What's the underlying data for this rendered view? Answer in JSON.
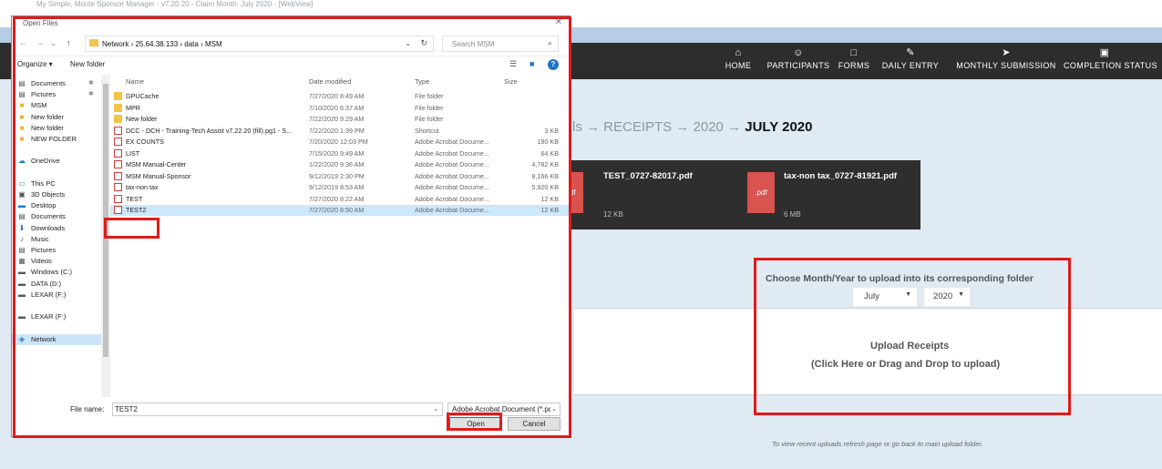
{
  "browser": {
    "tab_text": "My Simple, Monte Sponsor Manager - v7.20.20 - Claim Month: July 2020 - [WebView]"
  },
  "nav": {
    "items": [
      {
        "label": "HOME",
        "icon": "home-icon",
        "glyph": "⌂"
      },
      {
        "label": "PARTICIPANTS",
        "icon": "smile-icon",
        "glyph": "☺"
      },
      {
        "label": "FORMS",
        "icon": "clipboard-icon",
        "glyph": "□"
      },
      {
        "label": "DAILY ENTRY",
        "icon": "edit-icon",
        "glyph": "✎"
      },
      {
        "label": "MONTHLY SUBMISSION",
        "icon": "send-icon",
        "glyph": "➤"
      },
      {
        "label": "COMPLETION STATUS",
        "icon": "calendar-icon",
        "glyph": "▣"
      }
    ]
  },
  "breadcrumb": {
    "prefix": "ls → RECEIPTS → 2020 →",
    "current": "JULY 2020"
  },
  "files": [
    {
      "name": "TEST_0727-82017.pdf",
      "size": "12 KB",
      "badge": "pdf"
    },
    {
      "name": "tax-non tax_0727-81921.pdf",
      "size": "6 MB",
      "badge": ".pdf"
    }
  ],
  "upload": {
    "choose_title": "Choose Month/Year to upload into its corresponding folder",
    "month": "July",
    "year": "2020",
    "title": "Upload Receipts",
    "subtitle": "(Click Here or Drag and Drop to upload)",
    "hint": "To view recent uploads refresh page or go back to main upload folder."
  },
  "dialog": {
    "title": "Open Files",
    "address": "Network  ›  25.64.38.133  ›  data  ›  MSM",
    "search_placeholder": "Search MSM",
    "organize": "Organize ▾",
    "new_folder": "New folder",
    "nav_pane": [
      {
        "label": "Documents",
        "icon": "documents-icon",
        "glyph": "▤",
        "pinned": true
      },
      {
        "label": "Pictures",
        "icon": "pictures-icon",
        "glyph": "▤",
        "pinned": true
      },
      {
        "label": "MSM",
        "icon": "folder-icon",
        "glyph": "■"
      },
      {
        "label": "New folder",
        "icon": "folder-icon",
        "glyph": "■"
      },
      {
        "label": "New folder",
        "icon": "folder-icon",
        "glyph": "■"
      },
      {
        "label": "NEW FOLDER",
        "icon": "folder-icon",
        "glyph": "■"
      },
      {
        "label": "",
        "icon": "",
        "glyph": ""
      },
      {
        "label": "OneDrive",
        "icon": "cloud-icon",
        "glyph": "☁"
      },
      {
        "label": "",
        "icon": "",
        "glyph": ""
      },
      {
        "label": "This PC",
        "icon": "computer-icon",
        "glyph": "▭"
      },
      {
        "label": "3D Objects",
        "icon": "cube-icon",
        "glyph": "▣"
      },
      {
        "label": "Desktop",
        "icon": "desktop-icon",
        "glyph": "▬"
      },
      {
        "label": "Documents",
        "icon": "documents-icon",
        "glyph": "▤"
      },
      {
        "label": "Downloads",
        "icon": "download-icon",
        "glyph": "⬇"
      },
      {
        "label": "Music",
        "icon": "music-icon",
        "glyph": "♪"
      },
      {
        "label": "Pictures",
        "icon": "pictures-icon",
        "glyph": "▤"
      },
      {
        "label": "Videos",
        "icon": "videos-icon",
        "glyph": "▦"
      },
      {
        "label": "Windows (C:)",
        "icon": "drive-icon",
        "glyph": "▬"
      },
      {
        "label": "DATA (D:)",
        "icon": "drive-icon",
        "glyph": "▬"
      },
      {
        "label": "LEXAR (F:)",
        "icon": "drive-icon",
        "glyph": "▬"
      },
      {
        "label": "",
        "icon": "",
        "glyph": ""
      },
      {
        "label": "LEXAR (F:)",
        "icon": "drive-icon",
        "glyph": "▬"
      },
      {
        "label": "",
        "icon": "",
        "glyph": ""
      },
      {
        "label": "Network",
        "icon": "network-icon",
        "glyph": "◈",
        "selected": true
      }
    ],
    "columns": [
      "Name",
      "Date modified",
      "Type",
      "Size"
    ],
    "rows": [
      {
        "name": "GPUCache",
        "date": "7/27/2020 8:49 AM",
        "type": "File folder",
        "size": "",
        "kind": "folder"
      },
      {
        "name": "MPR",
        "date": "7/10/2020 6:37 AM",
        "type": "File folder",
        "size": "",
        "kind": "folder"
      },
      {
        "name": "New folder",
        "date": "7/22/2020 9:29 AM",
        "type": "File folder",
        "size": "",
        "kind": "folder"
      },
      {
        "name": "DCC - DCH - Training-Tech Assist v7.22.20 (fill) pg1 - S...",
        "date": "7/22/2020 1:39 PM",
        "type": "Shortcut",
        "size": "3 KB",
        "kind": "shortcut"
      },
      {
        "name": "EX COUNTS",
        "date": "7/20/2020 12:03 PM",
        "type": "Adobe Acrobat Docume...",
        "size": "190 KB",
        "kind": "pdf"
      },
      {
        "name": "LIST",
        "date": "7/15/2020 9:49 AM",
        "type": "Adobe Acrobat Docume...",
        "size": "64 KB",
        "kind": "pdf"
      },
      {
        "name": "MSM Manual-Center",
        "date": "1/22/2020 9:36 AM",
        "type": "Adobe Acrobat Docume...",
        "size": "4,782 KB",
        "kind": "pdf"
      },
      {
        "name": "MSM Manual-Sponsor",
        "date": "9/12/2019 2:30 PM",
        "type": "Adobe Acrobat Docume...",
        "size": "8,166 KB",
        "kind": "pdf"
      },
      {
        "name": "tax-non tax",
        "date": "9/12/2019 8:53 AM",
        "type": "Adobe Acrobat Docume...",
        "size": "5,920 KB",
        "kind": "pdf"
      },
      {
        "name": "TEST",
        "date": "7/27/2020 8:22 AM",
        "type": "Adobe Acrobat Docume...",
        "size": "12 KB",
        "kind": "pdf"
      },
      {
        "name": "TEST2",
        "date": "7/27/2020 8:50 AM",
        "type": "Adobe Acrobat Docume...",
        "size": "12 KB",
        "kind": "pdf",
        "selected": true
      }
    ],
    "file_name_label": "File name:",
    "file_name_value": "TEST2",
    "file_type": "Adobe Acrobat Document (*.pd",
    "open_label": "Open",
    "cancel_label": "Cancel"
  }
}
